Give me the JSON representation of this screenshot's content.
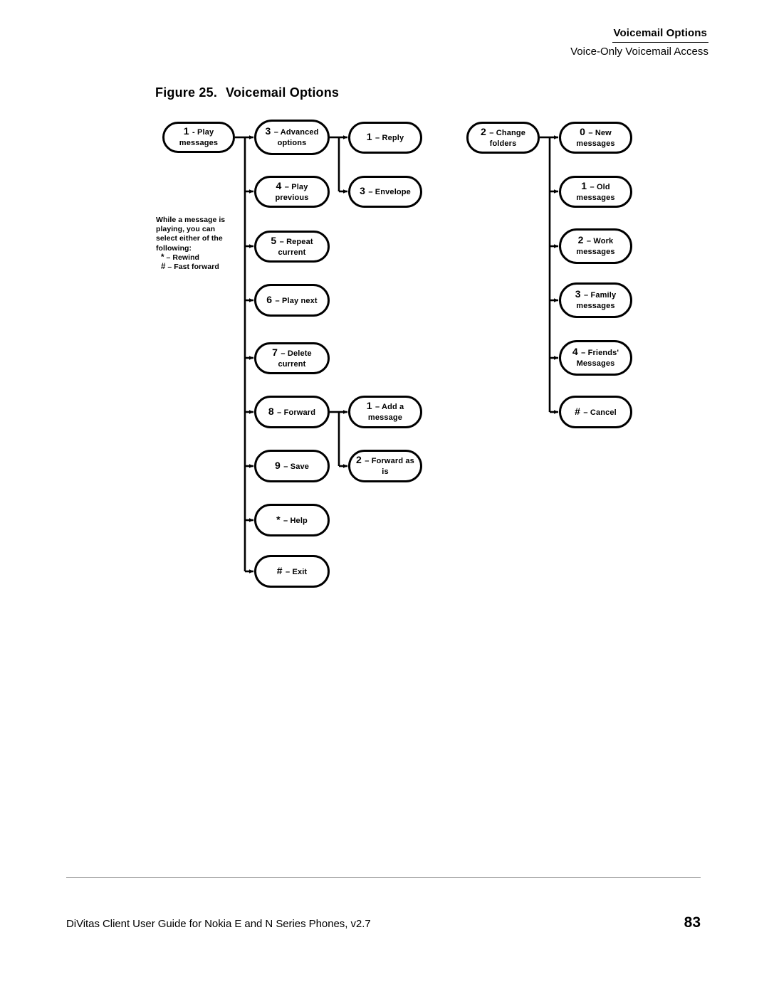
{
  "header": {
    "title": "Voicemail Options",
    "subtitle": "Voice-Only Voicemail Access"
  },
  "figure": {
    "number": "Figure 25.",
    "title": "Voicemail Options"
  },
  "note": {
    "line1": "While a message is",
    "line2": "playing, you can",
    "line3": "select either of the",
    "line4": "following:",
    "option1_symbol": "*",
    "option1_text": "– Rewind",
    "option2_symbol": "#",
    "option2_text": "– Fast forward"
  },
  "diagram": {
    "root": {
      "key": "1",
      "label": "- Play messages"
    },
    "play_messages_children": [
      {
        "key": "3",
        "label": "– Advanced",
        "label2": "options"
      },
      {
        "key": "4",
        "label": "– Play previous"
      },
      {
        "key": "5",
        "label": "– Repeat current"
      },
      {
        "key": "6",
        "label": "– Play next"
      },
      {
        "key": "7",
        "label": "– Delete current"
      },
      {
        "key": "8",
        "label": "– Forward"
      },
      {
        "key": "9",
        "label": "– Save"
      },
      {
        "key": "*",
        "label": "– Help"
      },
      {
        "key": "#",
        "label": "– Exit"
      }
    ],
    "advanced_options_children": [
      {
        "key": "1",
        "label": "– Reply"
      },
      {
        "key": "3",
        "label": "– Envelope"
      }
    ],
    "forward_children": [
      {
        "key": "1",
        "label": "– Add a message"
      },
      {
        "key": "2",
        "label": "– Forward as is"
      }
    ],
    "change_folders_root": {
      "key": "2",
      "label": "– Change folders"
    },
    "change_folders_children": [
      {
        "key": "0",
        "label": "– New messages"
      },
      {
        "key": "1",
        "label": "– Old messages"
      },
      {
        "key": "2",
        "label": "– Work",
        "label2": "messages"
      },
      {
        "key": "3",
        "label": "– Family",
        "label2": "messages"
      },
      {
        "key": "4",
        "label": "– Friends'",
        "label2": "Messages"
      },
      {
        "key": "#",
        "label": "– Cancel"
      }
    ]
  },
  "footer": {
    "text": "DiVitas Client User Guide for Nokia E and N Series Phones, v2.7",
    "page": "83"
  },
  "colors": {
    "ink": "#000000",
    "rule": "#9a9a9a",
    "paper": "#ffffff"
  }
}
